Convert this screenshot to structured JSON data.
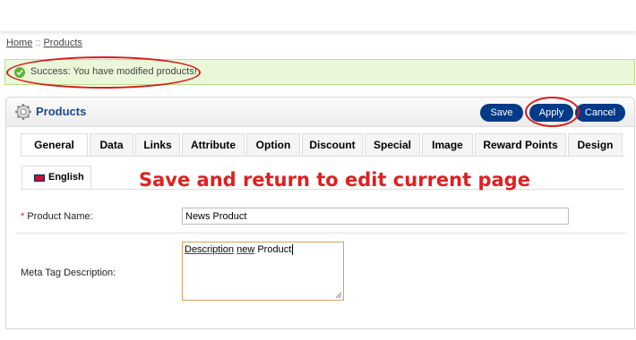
{
  "breadcrumb": {
    "home": "Home",
    "separator": "::",
    "current": "Products"
  },
  "alert": {
    "message": "Success: You have modified products!",
    "icon": "check-circle-icon",
    "color": "#5fb335"
  },
  "header": {
    "title": "Products",
    "icon": "gear-icon",
    "buttons": {
      "save": "Save",
      "apply": "Apply",
      "cancel": "Cancel"
    },
    "button_color": "#003a88"
  },
  "tabs": [
    {
      "label": "General",
      "active": true
    },
    {
      "label": "Data"
    },
    {
      "label": "Links"
    },
    {
      "label": "Attribute"
    },
    {
      "label": "Option"
    },
    {
      "label": "Discount"
    },
    {
      "label": "Special"
    },
    {
      "label": "Image"
    },
    {
      "label": "Reward Points"
    },
    {
      "label": "Design"
    }
  ],
  "language_tab": {
    "label": "English",
    "icon": "uk-flag-icon"
  },
  "annotation": {
    "text": "Save and return to edit current page",
    "color": "#e01f1f"
  },
  "form": {
    "product_name": {
      "required_mark": "*",
      "label": "Product Name:",
      "value": "News Product"
    },
    "meta_description": {
      "label": "Meta Tag Description:",
      "value_part1": "Description",
      "value_part2": "new",
      "value_part3": "Product"
    }
  }
}
